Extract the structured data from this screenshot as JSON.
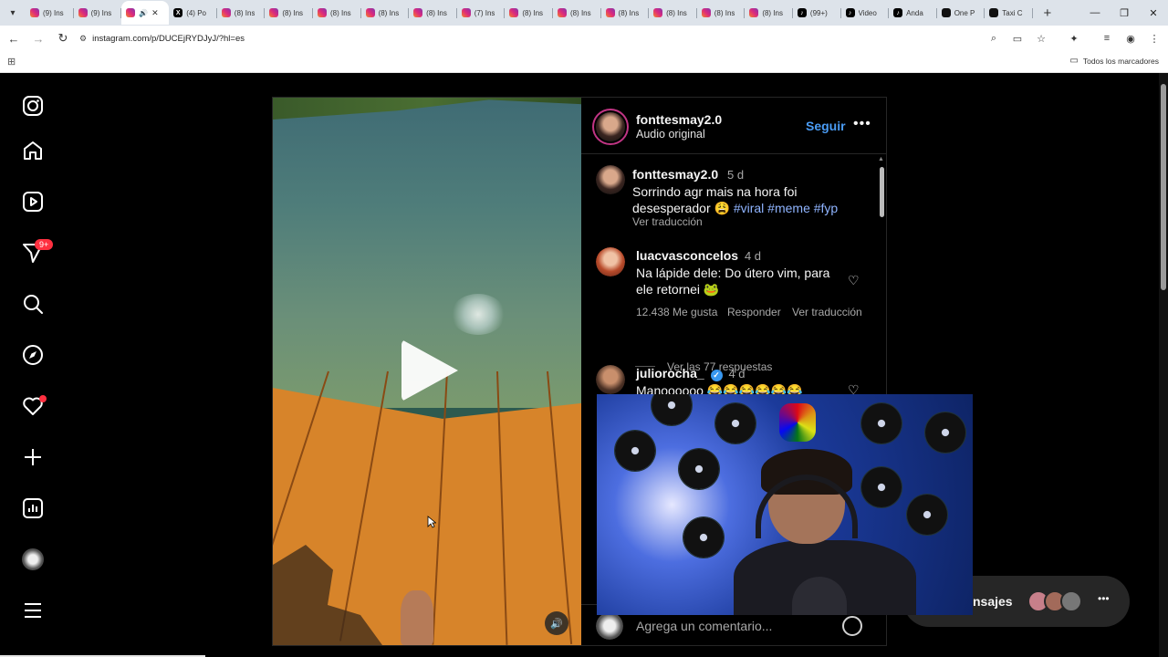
{
  "browser": {
    "tabs": [
      {
        "label": "(9) Ins",
        "icon": "instagram-icon",
        "fav": "ig"
      },
      {
        "label": "(9) Ins",
        "icon": "instagram-icon",
        "fav": "ig"
      },
      {
        "label": "",
        "icon": "instagram-icon",
        "fav": "ig",
        "active": true
      },
      {
        "label": "(4) Po",
        "icon": "x-icon",
        "fav": "x"
      },
      {
        "label": "(8) Ins",
        "icon": "instagram-icon",
        "fav": "ig"
      },
      {
        "label": "(8) Ins",
        "icon": "instagram-icon",
        "fav": "ig"
      },
      {
        "label": "(8) Ins",
        "icon": "instagram-icon",
        "fav": "ig"
      },
      {
        "label": "(8) Ins",
        "icon": "instagram-icon",
        "fav": "ig"
      },
      {
        "label": "(8) Ins",
        "icon": "instagram-icon",
        "fav": "ig"
      },
      {
        "label": "(7) Ins",
        "icon": "instagram-icon",
        "fav": "ig"
      },
      {
        "label": "(8) Ins",
        "icon": "instagram-icon",
        "fav": "ig"
      },
      {
        "label": "(8) Ins",
        "icon": "instagram-icon",
        "fav": "ig"
      },
      {
        "label": "(8) Ins",
        "icon": "instagram-icon",
        "fav": "ig"
      },
      {
        "label": "(8) Ins",
        "icon": "instagram-icon",
        "fav": "ig"
      },
      {
        "label": "(8) Ins",
        "icon": "instagram-icon",
        "fav": "ig"
      },
      {
        "label": "(8) Ins",
        "icon": "instagram-icon",
        "fav": "ig"
      },
      {
        "label": "(99+)",
        "icon": "tiktok-icon",
        "fav": "tt"
      },
      {
        "label": "Video",
        "icon": "tiktok-icon",
        "fav": "tt"
      },
      {
        "label": "Anda",
        "icon": "tiktok-icon",
        "fav": "tt"
      },
      {
        "label": "One P",
        "icon": "onepiece-icon",
        "fav": "op"
      },
      {
        "label": "Taxi C",
        "icon": "taxi-icon",
        "fav": "taxi"
      }
    ],
    "url": "instagram.com/p/DUCEjRYDJyJ/?hl=es",
    "bookmarks_all": "Todos los marcadores"
  },
  "post": {
    "author": "fonttesmay2.0",
    "audio": "Audio original",
    "follow": "Seguir",
    "caption": {
      "user": "fonttesmay2.0",
      "time": "5 d",
      "text": "Sorrindo agr mais na hora foi desesperador 😩",
      "hashtags": "#viral #meme #fyp",
      "translate": "Ver traducción"
    },
    "comments": [
      {
        "user": "luacvasconcelos",
        "time": "4 d",
        "text": "Na lápide dele: Do útero vim, para ele retornei 🐸",
        "likes": "12.438 Me gusta",
        "reply": "Responder",
        "translate": "Ver traducción",
        "view_replies": "Ver las 77 respuestas"
      },
      {
        "user": "juliorocha_",
        "time": "4 d",
        "text": "Manoooooo 😂😂😂😂😂😂"
      }
    ],
    "add_comment_placeholder": "Agrega un comentario..."
  },
  "nav": {
    "notifications_badge": "9+"
  },
  "messages": {
    "label": "nsajes"
  },
  "colors": {
    "accent": "#4a9cf5",
    "badge": "#ff3040"
  }
}
